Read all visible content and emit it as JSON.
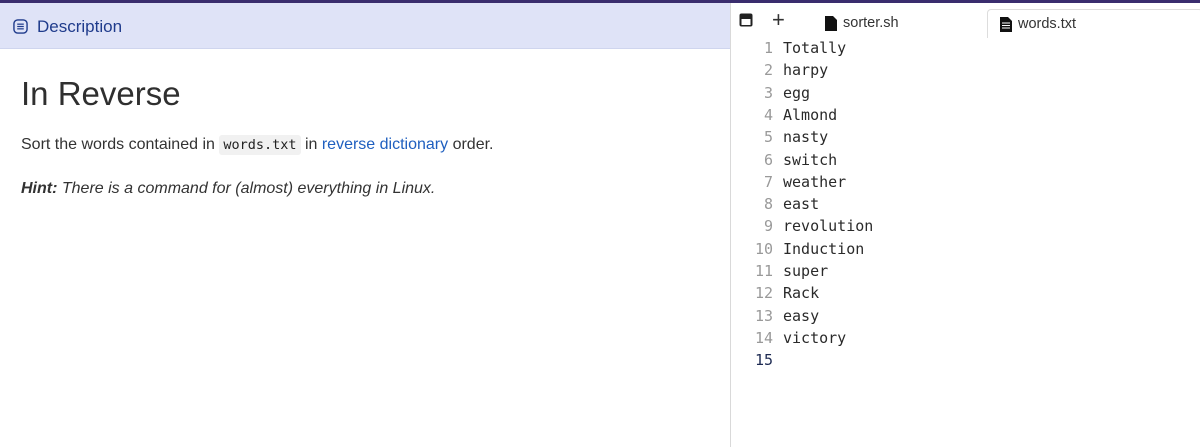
{
  "description": {
    "header_label": "Description",
    "title": "In Reverse",
    "para_before": "Sort the words contained in ",
    "para_code": "words.txt",
    "para_mid": " in ",
    "para_link": "reverse dictionary",
    "para_after": " order.",
    "hint_label": "Hint:",
    "hint_text": " There is a command for (almost) everything in Linux."
  },
  "editor": {
    "tabs": [
      {
        "label": "sorter.sh"
      },
      {
        "label": "words.txt"
      }
    ],
    "lines": [
      {
        "num": "1",
        "text": "Totally"
      },
      {
        "num": "2",
        "text": "harpy"
      },
      {
        "num": "3",
        "text": "egg"
      },
      {
        "num": "4",
        "text": "Almond"
      },
      {
        "num": "5",
        "text": "nasty"
      },
      {
        "num": "6",
        "text": "switch"
      },
      {
        "num": "7",
        "text": "weather"
      },
      {
        "num": "8",
        "text": "east"
      },
      {
        "num": "9",
        "text": "revolution"
      },
      {
        "num": "10",
        "text": "Induction"
      },
      {
        "num": "11",
        "text": "super"
      },
      {
        "num": "12",
        "text": "Rack"
      },
      {
        "num": "13",
        "text": "easy"
      },
      {
        "num": "14",
        "text": "victory"
      },
      {
        "num": "15",
        "text": ""
      }
    ]
  },
  "colors": {
    "accent": "#1f3b8c",
    "link": "#1f5fbf",
    "header_bg": "#dfe3f7"
  }
}
